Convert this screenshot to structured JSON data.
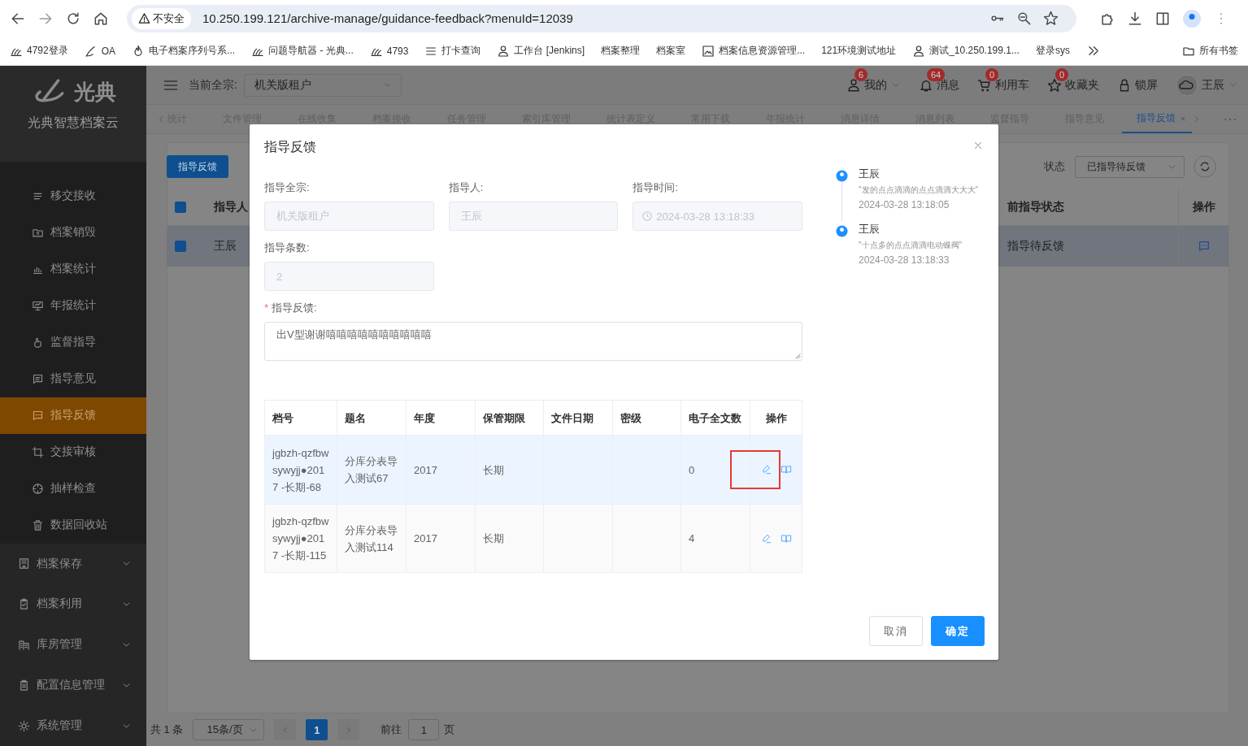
{
  "browser": {
    "security": "不安全",
    "url": "10.250.199.121/archive-manage/guidance-feedback?menuId=12039",
    "bookmarks": [
      "4792登录",
      "OA",
      "电子档案序列号系...",
      "问题导航器 - 光典...",
      "4793",
      "打卡查询",
      "工作台 [Jenkins]",
      "档案整理",
      "档案室",
      "档案信息资源管理...",
      "121环境测试地址",
      "测试_10.250.199.1...",
      "登录sys"
    ],
    "all_bookmarks": "所有书签"
  },
  "sidebar": {
    "brand": "光典",
    "subtitle": "光典智慧档案云",
    "items": [
      {
        "label": "移交接收",
        "selected": false
      },
      {
        "label": "档案销毁",
        "selected": false
      },
      {
        "label": "档案统计",
        "selected": false
      },
      {
        "label": "年报统计",
        "selected": false
      },
      {
        "label": "监督指导",
        "selected": false
      },
      {
        "label": "指导意见",
        "selected": false
      },
      {
        "label": "指导反馈",
        "selected": true
      },
      {
        "label": "交接审核",
        "selected": false
      },
      {
        "label": "抽样检查",
        "selected": false
      },
      {
        "label": "数据回收站",
        "selected": false
      }
    ],
    "groups": [
      "档案保存",
      "档案利用",
      "库房管理",
      "配置信息管理",
      "系统管理"
    ]
  },
  "header": {
    "fonds_label": "当前全宗:",
    "fonds": "机关版租户",
    "actions": [
      {
        "label": "我的",
        "badge": "6"
      },
      {
        "label": "消息",
        "badge": "64"
      },
      {
        "label": "利用车",
        "badge": "0"
      },
      {
        "label": "收藏夹",
        "badge": "0"
      },
      {
        "label": "锁屏"
      }
    ],
    "user": "王辰"
  },
  "tabs": [
    {
      "label": "统计",
      "selected": false
    },
    {
      "label": "文件管理",
      "selected": false
    },
    {
      "label": "在线收集",
      "selected": false
    },
    {
      "label": "档案接收",
      "selected": false
    },
    {
      "label": "任务管理",
      "selected": false
    },
    {
      "label": "索引库管理",
      "selected": false
    },
    {
      "label": "统计表定义",
      "selected": false
    },
    {
      "label": "常用下载",
      "selected": false
    },
    {
      "label": "年报统计",
      "selected": false
    },
    {
      "label": "消息详情",
      "selected": false
    },
    {
      "label": "消息列表",
      "selected": false
    },
    {
      "label": "监督指导",
      "selected": false
    },
    {
      "label": "指导意见",
      "selected": false
    },
    {
      "label": "指导反馈",
      "selected": true
    }
  ],
  "page": {
    "action_button": "指导反馈",
    "status_label": "状态",
    "status": "已指导待反馈",
    "table": {
      "header_checked": true,
      "columns": [
        "指导人",
        "前指导状态",
        "操作"
      ],
      "rows": [
        {
          "checked": true,
          "cells": [
            "王辰",
            "指导待反馈"
          ]
        }
      ]
    },
    "pagination": {
      "total": "共 1 条",
      "page_size": "15条/页",
      "current": "1",
      "goto_label": "前往",
      "goto": "1",
      "page_suffix": "页"
    }
  },
  "modal": {
    "title": "指导反馈",
    "fields": [
      {
        "label": "指导全宗:",
        "value": "机关版租户",
        "kind": "text",
        "disabled": true
      },
      {
        "label": "指导人:",
        "value": "王辰",
        "kind": "text",
        "disabled": true
      },
      {
        "label": "指导时间:",
        "value": "2024-03-28 13:18:33",
        "kind": "date",
        "disabled": true
      },
      {
        "label": "指导条数:",
        "value": "2",
        "kind": "text",
        "disabled": true
      }
    ],
    "feedback": {
      "required_mark": "*",
      "label": "指导反馈:",
      "value": "出V型谢谢嘻嘻嘻嘻嘻嘻嘻嘻嘻嘻"
    },
    "table": {
      "columns": [
        "档号",
        "题名",
        "年度",
        "保管期限",
        "文件日期",
        "密级",
        "电子全文数",
        "操作"
      ],
      "rows": [
        {
          "cells": [
            "jgbzh-qzfbw sywyjj●2017 -长期-68",
            "分库分表导入测试67",
            "2017",
            "长期",
            "",
            "",
            "0"
          ],
          "highlighted": true
        },
        {
          "cells": [
            "jgbzh-qzfbw sywyjj●2017 -长期-115",
            "分库分表导入测试114",
            "2017",
            "长期",
            "",
            "",
            "4"
          ],
          "highlighted": false
        }
      ]
    },
    "timeline": [
      {
        "name": "王辰",
        "comment": "\"发的点点滴滴的点点滴滴大大大\"",
        "time": "2024-03-28 13:18:05"
      },
      {
        "name": "王辰",
        "comment": "\"十点多的点点滴滴电动蝶阀\"",
        "time": "2024-03-28 13:18:33"
      }
    ],
    "buttons": [
      {
        "label": "取消",
        "kind": "secondary"
      },
      {
        "label": "确定",
        "kind": "primary"
      }
    ]
  }
}
